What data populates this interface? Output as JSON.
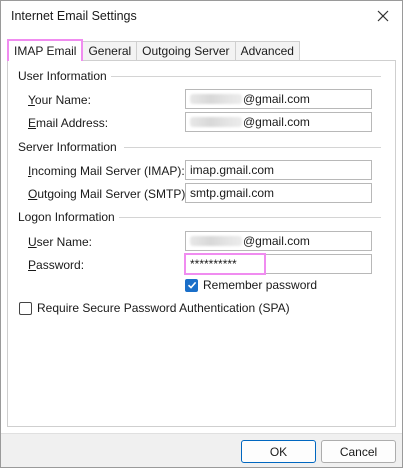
{
  "window": {
    "title": "Internet Email Settings"
  },
  "tabs": [
    {
      "label": "IMAP Email",
      "active": true
    },
    {
      "label": "General",
      "active": false
    },
    {
      "label": "Outgoing Server",
      "active": false
    },
    {
      "label": "Advanced",
      "active": false
    }
  ],
  "user_info": {
    "title": "User Information",
    "your_name_label": {
      "mn": "Y",
      "rest": "our Name:"
    },
    "your_name_value": "@gmail.com",
    "email_label": {
      "mn": "E",
      "rest": "mail Address:"
    },
    "email_value": "@gmail.com"
  },
  "server_info": {
    "title": "Server Information",
    "incoming_label": {
      "mn": "I",
      "rest": "ncoming Mail Server (IMAP):"
    },
    "incoming_value": "imap.gmail.com",
    "outgoing_label": {
      "mn": "O",
      "rest": "utgoing Mail Server (SMTP):"
    },
    "outgoing_value": "smtp.gmail.com"
  },
  "logon_info": {
    "title": "Logon Information",
    "user_name_label": {
      "mn": "U",
      "rest": "ser Name:"
    },
    "user_name_value": "@gmail.com",
    "password_label": {
      "mn": "P",
      "rest": "assword:"
    },
    "password_value": "**********",
    "remember_label": {
      "mn": "R",
      "rest": "emember password"
    },
    "remember_checked": true
  },
  "spa": {
    "label_pre": "Re",
    "label_mn": "q",
    "label_post": "uire Secure Password Authentication (SPA)",
    "checked": false
  },
  "footer": {
    "ok_label": "OK",
    "cancel_label": "Cancel"
  },
  "colors": {
    "highlight": "#f08cf0",
    "accent": "#0067c0",
    "checkbox": "#1a6fc9"
  },
  "icons": {
    "close": "close-icon",
    "check": "check-icon"
  }
}
